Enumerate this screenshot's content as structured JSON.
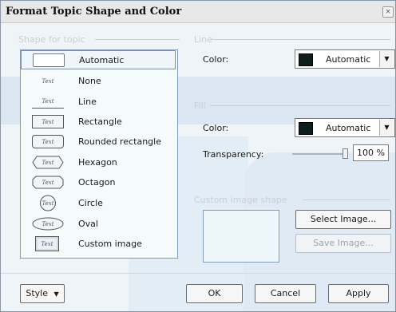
{
  "window": {
    "title": "Format Topic Shape and Color",
    "close_glyph": "×"
  },
  "shape_group": {
    "label": "Shape for topic",
    "items": [
      {
        "label": "Automatic",
        "thumb": "",
        "selected": true
      },
      {
        "label": "None",
        "thumb": "Text"
      },
      {
        "label": "Line",
        "thumb": "Text"
      },
      {
        "label": "Rectangle",
        "thumb": "Text"
      },
      {
        "label": "Rounded rectangle",
        "thumb": "Text"
      },
      {
        "label": "Hexagon",
        "thumb": "Text"
      },
      {
        "label": "Octagon",
        "thumb": "Text"
      },
      {
        "label": "Circle",
        "thumb": "Text"
      },
      {
        "label": "Oval",
        "thumb": "Text"
      },
      {
        "label": "Custom image",
        "thumb": "Text"
      }
    ]
  },
  "line_group": {
    "label": "Line",
    "color_label": "Color:",
    "color_value": "Automatic",
    "swatch_color": "#0e1e1c"
  },
  "fill_group": {
    "label": "Fill",
    "color_label": "Color:",
    "color_value": "Automatic",
    "swatch_color": "#0e1e1c",
    "transparency_label": "Transparency:",
    "transparency_value": "100 %",
    "transparency_level": 1.0
  },
  "image_group": {
    "label": "Custom image shape",
    "select_button": "Select Image...",
    "save_button": "Save Image..."
  },
  "footer": {
    "style_button": "Style",
    "ok_button": "OK",
    "cancel_button": "Cancel",
    "apply_button": "Apply"
  }
}
